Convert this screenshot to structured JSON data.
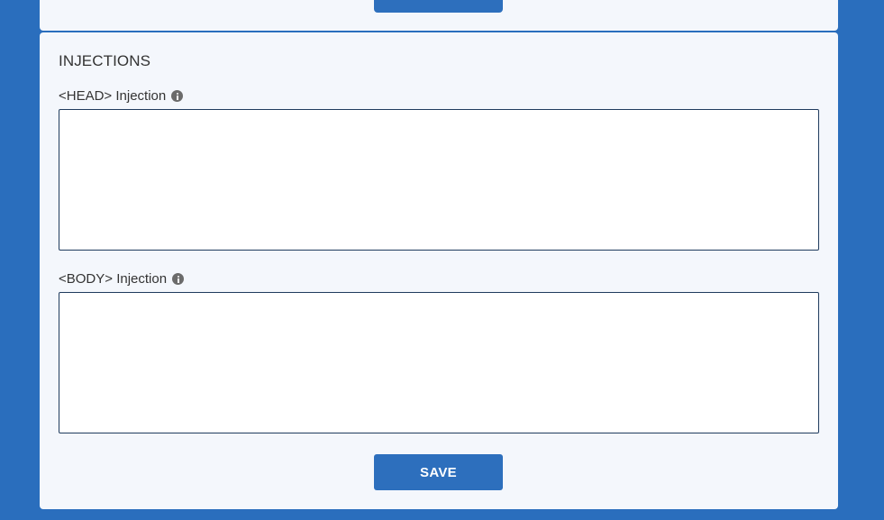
{
  "section": {
    "title": "INJECTIONS"
  },
  "fields": {
    "head": {
      "label": "<HEAD> Injection",
      "value": "",
      "info_icon": "info-circle-icon"
    },
    "body": {
      "label": "<BODY> Injection",
      "value": "",
      "info_icon": "info-circle-icon"
    }
  },
  "actions": {
    "save_label": "SAVE"
  },
  "colors": {
    "page_background": "#2a6ebd",
    "panel_background": "#f4f7fc",
    "button_background": "#2d6fbd",
    "button_text": "#ffffff",
    "textarea_border": "#1f3b5e",
    "text": "#333333"
  }
}
